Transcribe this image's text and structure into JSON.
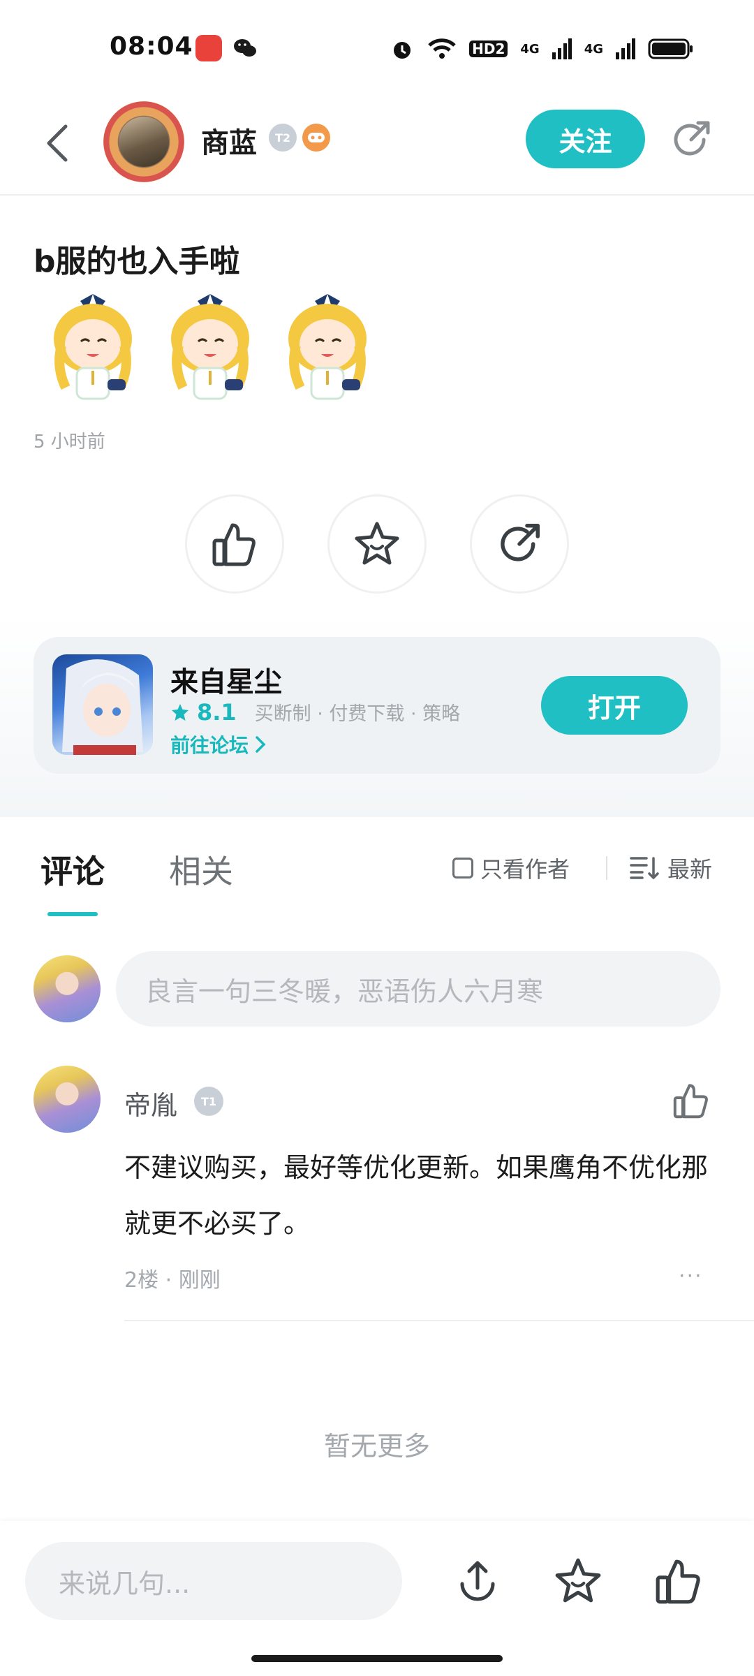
{
  "status_bar": {
    "time": "08:04",
    "network_label_1": "4G",
    "network_label_2": "4G",
    "hd_label": "HD2"
  },
  "header": {
    "author_name": "商蓝",
    "level_badge": "T2",
    "follow_label": "关注"
  },
  "post": {
    "title": "b服的也入手啦",
    "time": "5 小时前",
    "sticker_count": 3
  },
  "app_card": {
    "name": "来自星尘",
    "score": "8.1",
    "tags": "买断制 · 付费下载 · 策略",
    "forum_link": "前往论坛",
    "open_label": "打开"
  },
  "tabs": {
    "comments": "评论",
    "related": "相关",
    "author_only": "只看作者",
    "sort": "最新"
  },
  "comment_input": {
    "placeholder": "良言一句三冬暖，恶语伤人六月寒"
  },
  "comments": [
    {
      "user": "帝胤",
      "badge": "T1",
      "text": "不建议购买，最好等优化更新。如果鹰角不优化那就更不必买了。",
      "floor_time": "2楼 · 刚刚",
      "more": "···"
    }
  ],
  "footer_text": "暂无更多",
  "bottom_bar": {
    "input_placeholder": "来说几句..."
  },
  "colors": {
    "accent": "#1fbfc4",
    "text_primary": "#1b1b1b",
    "text_secondary": "#a3a8ad"
  }
}
